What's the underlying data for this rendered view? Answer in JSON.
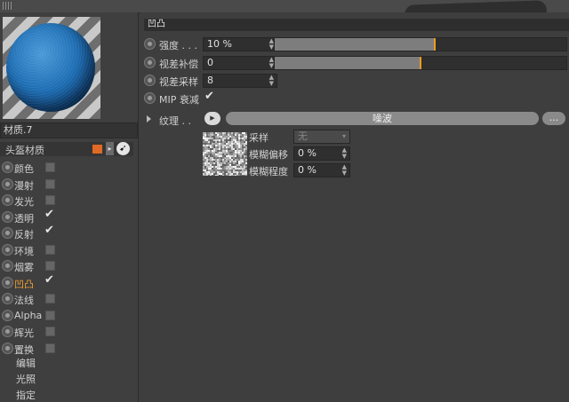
{
  "material": {
    "name": "材质.7",
    "header_label": "头盔材质",
    "accent_color": "#e06a24"
  },
  "channels": [
    {
      "label": "颜色",
      "checked": false
    },
    {
      "label": "漫射",
      "checked": false
    },
    {
      "label": "发光",
      "checked": false
    },
    {
      "label": "透明",
      "checked": true
    },
    {
      "label": "反射",
      "checked": true
    },
    {
      "label": "环境",
      "checked": false
    },
    {
      "label": "烟雾",
      "checked": false
    },
    {
      "label": "凹凸",
      "checked": true,
      "active": true
    },
    {
      "label": "法线",
      "checked": false
    },
    {
      "label": "Alpha",
      "checked": false
    },
    {
      "label": "辉光",
      "checked": false
    },
    {
      "label": "置换",
      "checked": false
    }
  ],
  "extra_items": [
    "编辑",
    "光照",
    "指定"
  ],
  "section": {
    "title": "凹凸"
  },
  "params": {
    "strength": {
      "label": "强度 . . .",
      "value": "10 %",
      "slider_fraction": 0.55
    },
    "parallax_offset": {
      "label": "视差补偿",
      "value": "0",
      "slider_fraction": 0.5
    },
    "parallax_samples": {
      "label": "视差采样",
      "value": "8"
    },
    "mip_falloff": {
      "label": "MIP 衰减",
      "checked": true
    }
  },
  "texture": {
    "label": "纹理 . .",
    "arrow_icon": "play-icon",
    "shader_name": "噪波",
    "more_label": "..."
  },
  "sampling": {
    "sample_label": "采样",
    "sample_value": "无",
    "blur_offset_label": "模糊偏移",
    "blur_offset_value": "0 %",
    "blur_scale_label": "模糊程度",
    "blur_scale_value": "0 %"
  },
  "colors": {
    "slider_marker": "#f09a20",
    "active_channel": "#f0a030"
  }
}
